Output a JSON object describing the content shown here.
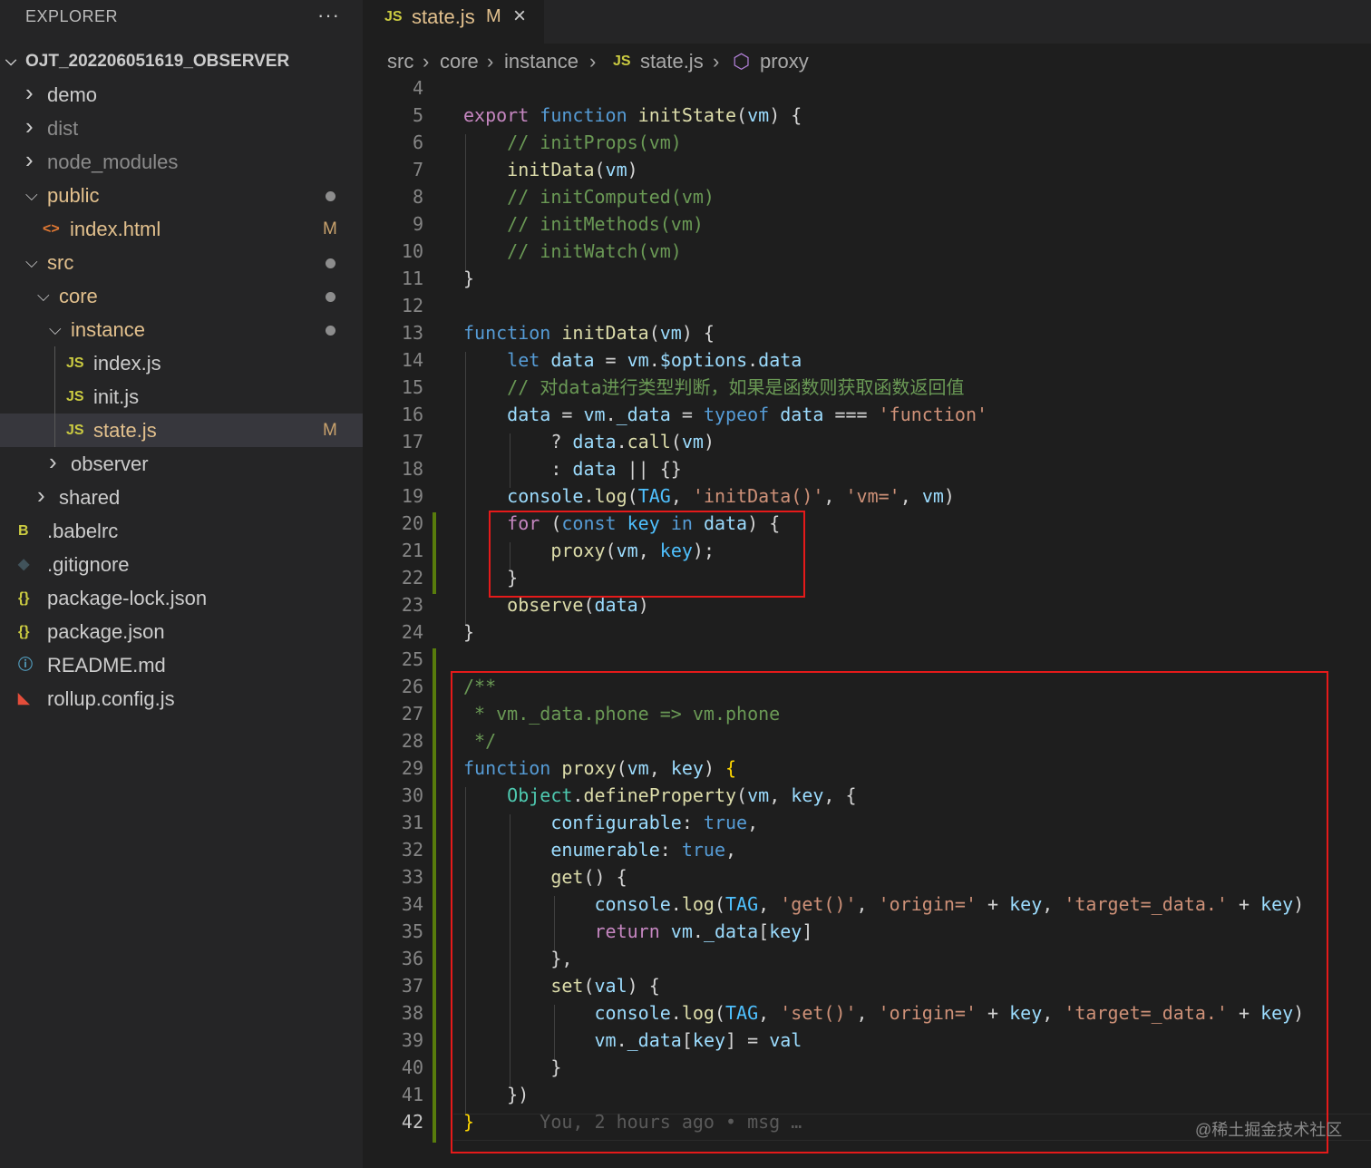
{
  "explorer": {
    "title": "EXPLORER",
    "more": "···",
    "root_label": "OJT_202206051619_OBSERVER",
    "items": [
      {
        "label": "demo",
        "kind": "folder",
        "state": "collapsed",
        "depth": 0
      },
      {
        "label": "dist",
        "kind": "folder",
        "state": "collapsed",
        "depth": 0
      },
      {
        "label": "node_modules",
        "kind": "folder",
        "state": "collapsed",
        "depth": 0
      },
      {
        "label": "public",
        "kind": "folder",
        "state": "expanded",
        "depth": 0
      },
      {
        "label": "index.html",
        "kind": "file",
        "icon": "<>",
        "badge": "M",
        "depth": 1
      },
      {
        "label": "src",
        "kind": "folder",
        "state": "expanded",
        "depth": 0
      },
      {
        "label": "core",
        "kind": "folder",
        "state": "expanded",
        "depth": 1
      },
      {
        "label": "instance",
        "kind": "folder",
        "state": "expanded",
        "depth": 2
      },
      {
        "label": "index.js",
        "kind": "file",
        "icon": "JS",
        "depth": 3
      },
      {
        "label": "init.js",
        "kind": "file",
        "icon": "JS",
        "depth": 3
      },
      {
        "label": "state.js",
        "kind": "file",
        "icon": "JS",
        "badge": "M",
        "depth": 3,
        "selected": true
      },
      {
        "label": "observer",
        "kind": "folder",
        "state": "collapsed",
        "depth": 2
      },
      {
        "label": "shared",
        "kind": "folder",
        "state": "collapsed",
        "depth": 1
      },
      {
        "label": ".babelrc",
        "kind": "file",
        "icon": "B",
        "depth": 0
      },
      {
        "label": ".gitignore",
        "kind": "file",
        "icon": "◆",
        "depth": 0
      },
      {
        "label": "package-lock.json",
        "kind": "file",
        "icon": "{}",
        "depth": 0
      },
      {
        "label": "package.json",
        "kind": "file",
        "icon": "{}",
        "depth": 0
      },
      {
        "label": "README.md",
        "kind": "file",
        "icon": "ⓘ",
        "depth": 0
      },
      {
        "label": "rollup.config.js",
        "kind": "file",
        "icon": "R",
        "depth": 0
      }
    ]
  },
  "tab": {
    "icon": "JS",
    "name": "state.js",
    "modified": "M",
    "close": "×"
  },
  "breadcrumb": {
    "parts": [
      "src",
      "core",
      "instance",
      "state.js",
      "proxy"
    ],
    "sep": "›",
    "js_icon": "JS",
    "symbol_icon": "⬡"
  },
  "editor": {
    "lines": [
      {
        "n": "4",
        "t": [
          [
            "pl",
            ""
          ]
        ]
      },
      {
        "n": "5",
        "t": [
          [
            "kw",
            "export "
          ],
          [
            "st",
            "function "
          ],
          [
            "fn",
            "initState"
          ],
          [
            "pl",
            "("
          ],
          [
            "vr",
            "vm"
          ],
          [
            "pl",
            ") {"
          ]
        ]
      },
      {
        "n": "6",
        "t": [
          [
            "pl",
            "    "
          ],
          [
            "cm",
            "// initProps(vm)"
          ]
        ]
      },
      {
        "n": "7",
        "t": [
          [
            "pl",
            "    "
          ],
          [
            "fn",
            "initData"
          ],
          [
            "pl",
            "("
          ],
          [
            "vr",
            "vm"
          ],
          [
            "pl",
            ")"
          ]
        ]
      },
      {
        "n": "8",
        "t": [
          [
            "pl",
            "    "
          ],
          [
            "cm",
            "// initComputed(vm)"
          ]
        ]
      },
      {
        "n": "9",
        "t": [
          [
            "pl",
            "    "
          ],
          [
            "cm",
            "// initMethods(vm)"
          ]
        ]
      },
      {
        "n": "10",
        "t": [
          [
            "pl",
            "    "
          ],
          [
            "cm",
            "// initWatch(vm)"
          ]
        ]
      },
      {
        "n": "11",
        "t": [
          [
            "pl",
            "}"
          ]
        ]
      },
      {
        "n": "12",
        "t": [
          [
            "pl",
            ""
          ]
        ]
      },
      {
        "n": "13",
        "t": [
          [
            "st",
            "function "
          ],
          [
            "fn",
            "initData"
          ],
          [
            "pl",
            "("
          ],
          [
            "vr",
            "vm"
          ],
          [
            "pl",
            ") {"
          ]
        ]
      },
      {
        "n": "14",
        "t": [
          [
            "pl",
            "    "
          ],
          [
            "st",
            "let "
          ],
          [
            "vr",
            "data"
          ],
          [
            "pl",
            " = "
          ],
          [
            "vr",
            "vm"
          ],
          [
            "pl",
            "."
          ],
          [
            "vr",
            "$options"
          ],
          [
            "pl",
            "."
          ],
          [
            "vr",
            "data"
          ]
        ]
      },
      {
        "n": "15",
        "t": [
          [
            "pl",
            "    "
          ],
          [
            "cm",
            "// 对data进行类型判断，如果是函数则获取函数返回值"
          ]
        ]
      },
      {
        "n": "16",
        "t": [
          [
            "pl",
            "    "
          ],
          [
            "vr",
            "data"
          ],
          [
            "pl",
            " = "
          ],
          [
            "vr",
            "vm"
          ],
          [
            "pl",
            "."
          ],
          [
            "vr",
            "_data"
          ],
          [
            "pl",
            " = "
          ],
          [
            "st",
            "typeof "
          ],
          [
            "vr",
            "data"
          ],
          [
            "pl",
            " === "
          ],
          [
            "str",
            "'function'"
          ]
        ]
      },
      {
        "n": "17",
        "t": [
          [
            "pl",
            "        ? "
          ],
          [
            "vr",
            "data"
          ],
          [
            "pl",
            "."
          ],
          [
            "fn",
            "call"
          ],
          [
            "pl",
            "("
          ],
          [
            "vr",
            "vm"
          ],
          [
            "pl",
            ")"
          ]
        ]
      },
      {
        "n": "18",
        "t": [
          [
            "pl",
            "        : "
          ],
          [
            "vr",
            "data"
          ],
          [
            "pl",
            " || {}"
          ]
        ]
      },
      {
        "n": "19",
        "t": [
          [
            "pl",
            "    "
          ],
          [
            "vr",
            "console"
          ],
          [
            "pl",
            "."
          ],
          [
            "fn",
            "log"
          ],
          [
            "pl",
            "("
          ],
          [
            "cn",
            "TAG"
          ],
          [
            "pl",
            ", "
          ],
          [
            "str",
            "'initData()'"
          ],
          [
            "pl",
            ", "
          ],
          [
            "str",
            "'vm='"
          ],
          [
            "pl",
            ", "
          ],
          [
            "vr",
            "vm"
          ],
          [
            "pl",
            ")"
          ]
        ]
      },
      {
        "n": "20",
        "t": [
          [
            "pl",
            "    "
          ],
          [
            "kw",
            "for"
          ],
          [
            "pl",
            " ("
          ],
          [
            "st",
            "const "
          ],
          [
            "cn",
            "key"
          ],
          [
            "pl",
            " "
          ],
          [
            "st",
            "in "
          ],
          [
            "vr",
            "data"
          ],
          [
            "pl",
            ") {"
          ]
        ]
      },
      {
        "n": "21",
        "t": [
          [
            "pl",
            "        "
          ],
          [
            "fn",
            "proxy"
          ],
          [
            "pl",
            "("
          ],
          [
            "vr",
            "vm"
          ],
          [
            "pl",
            ", "
          ],
          [
            "cn",
            "key"
          ],
          [
            "pl",
            ");"
          ]
        ]
      },
      {
        "n": "22",
        "t": [
          [
            "pl",
            "    }"
          ]
        ]
      },
      {
        "n": "23",
        "t": [
          [
            "pl",
            "    "
          ],
          [
            "fn",
            "observe"
          ],
          [
            "pl",
            "("
          ],
          [
            "vr",
            "data"
          ],
          [
            "pl",
            ")"
          ]
        ]
      },
      {
        "n": "24",
        "t": [
          [
            "pl",
            "}"
          ]
        ]
      },
      {
        "n": "25",
        "t": [
          [
            "pl",
            ""
          ]
        ]
      },
      {
        "n": "26",
        "t": [
          [
            "cm",
            "/**"
          ]
        ]
      },
      {
        "n": "27",
        "t": [
          [
            "cm",
            " * vm._data.phone => vm.phone"
          ]
        ]
      },
      {
        "n": "28",
        "t": [
          [
            "cm",
            " */"
          ]
        ]
      },
      {
        "n": "29",
        "t": [
          [
            "st",
            "function "
          ],
          [
            "fn",
            "proxy"
          ],
          [
            "pl",
            "("
          ],
          [
            "vr",
            "vm"
          ],
          [
            "pl",
            ", "
          ],
          [
            "vr",
            "key"
          ],
          [
            "pl",
            ") "
          ],
          [
            "pr",
            "{"
          ]
        ]
      },
      {
        "n": "30",
        "t": [
          [
            "pl",
            "    "
          ],
          [
            "ty",
            "Object"
          ],
          [
            "pl",
            "."
          ],
          [
            "fn",
            "defineProperty"
          ],
          [
            "pl",
            "("
          ],
          [
            "vr",
            "vm"
          ],
          [
            "pl",
            ", "
          ],
          [
            "vr",
            "key"
          ],
          [
            "pl",
            ", {"
          ]
        ]
      },
      {
        "n": "31",
        "t": [
          [
            "pl",
            "        "
          ],
          [
            "vr",
            "configurable"
          ],
          [
            "pl",
            ": "
          ],
          [
            "bl",
            "true"
          ],
          [
            "pl",
            ","
          ]
        ]
      },
      {
        "n": "32",
        "t": [
          [
            "pl",
            "        "
          ],
          [
            "vr",
            "enumerable"
          ],
          [
            "pl",
            ": "
          ],
          [
            "bl",
            "true"
          ],
          [
            "pl",
            ","
          ]
        ]
      },
      {
        "n": "33",
        "t": [
          [
            "pl",
            "        "
          ],
          [
            "fn",
            "get"
          ],
          [
            "pl",
            "() {"
          ]
        ]
      },
      {
        "n": "34",
        "t": [
          [
            "pl",
            "            "
          ],
          [
            "vr",
            "console"
          ],
          [
            "pl",
            "."
          ],
          [
            "fn",
            "log"
          ],
          [
            "pl",
            "("
          ],
          [
            "cn",
            "TAG"
          ],
          [
            "pl",
            ", "
          ],
          [
            "str",
            "'get()'"
          ],
          [
            "pl",
            ", "
          ],
          [
            "str",
            "'origin='"
          ],
          [
            "pl",
            " + "
          ],
          [
            "vr",
            "key"
          ],
          [
            "pl",
            ", "
          ],
          [
            "str",
            "'target=_data.'"
          ],
          [
            "pl",
            " + "
          ],
          [
            "vr",
            "key"
          ],
          [
            "pl",
            ")"
          ]
        ]
      },
      {
        "n": "35",
        "t": [
          [
            "pl",
            "            "
          ],
          [
            "kw",
            "return "
          ],
          [
            "vr",
            "vm"
          ],
          [
            "pl",
            "."
          ],
          [
            "vr",
            "_data"
          ],
          [
            "pl",
            "["
          ],
          [
            "vr",
            "key"
          ],
          [
            "pl",
            "]"
          ]
        ]
      },
      {
        "n": "36",
        "t": [
          [
            "pl",
            "        },"
          ]
        ]
      },
      {
        "n": "37",
        "t": [
          [
            "pl",
            "        "
          ],
          [
            "fn",
            "set"
          ],
          [
            "pl",
            "("
          ],
          [
            "vr",
            "val"
          ],
          [
            "pl",
            ") {"
          ]
        ]
      },
      {
        "n": "38",
        "t": [
          [
            "pl",
            "            "
          ],
          [
            "vr",
            "console"
          ],
          [
            "pl",
            "."
          ],
          [
            "fn",
            "log"
          ],
          [
            "pl",
            "("
          ],
          [
            "cn",
            "TAG"
          ],
          [
            "pl",
            ", "
          ],
          [
            "str",
            "'set()'"
          ],
          [
            "pl",
            ", "
          ],
          [
            "str",
            "'origin='"
          ],
          [
            "pl",
            " + "
          ],
          [
            "vr",
            "key"
          ],
          [
            "pl",
            ", "
          ],
          [
            "str",
            "'target=_data.'"
          ],
          [
            "pl",
            " + "
          ],
          [
            "vr",
            "key"
          ],
          [
            "pl",
            ")"
          ]
        ]
      },
      {
        "n": "39",
        "t": [
          [
            "pl",
            "            "
          ],
          [
            "vr",
            "vm"
          ],
          [
            "pl",
            "."
          ],
          [
            "vr",
            "_data"
          ],
          [
            "pl",
            "["
          ],
          [
            "vr",
            "key"
          ],
          [
            "pl",
            "] = "
          ],
          [
            "vr",
            "val"
          ]
        ]
      },
      {
        "n": "40",
        "t": [
          [
            "pl",
            "        }"
          ]
        ]
      },
      {
        "n": "41",
        "t": [
          [
            "pl",
            "    })"
          ]
        ]
      },
      {
        "n": "42",
        "t": [
          [
            "pr",
            "}"
          ],
          [
            "gh",
            "      You, 2 hours ago • msg …"
          ]
        ]
      }
    ],
    "active_line": "42"
  },
  "watermark": "@稀土掘金技术社区",
  "colors": {
    "sidebar_bg": "#252526",
    "editor_bg": "#1e1e1e",
    "modified": "#e2c08d",
    "folder_modified": "#e2c08d",
    "js_icon": "#cbcb41",
    "highlight_box": "#e51a1a",
    "git_gutter": "#587c0c"
  }
}
